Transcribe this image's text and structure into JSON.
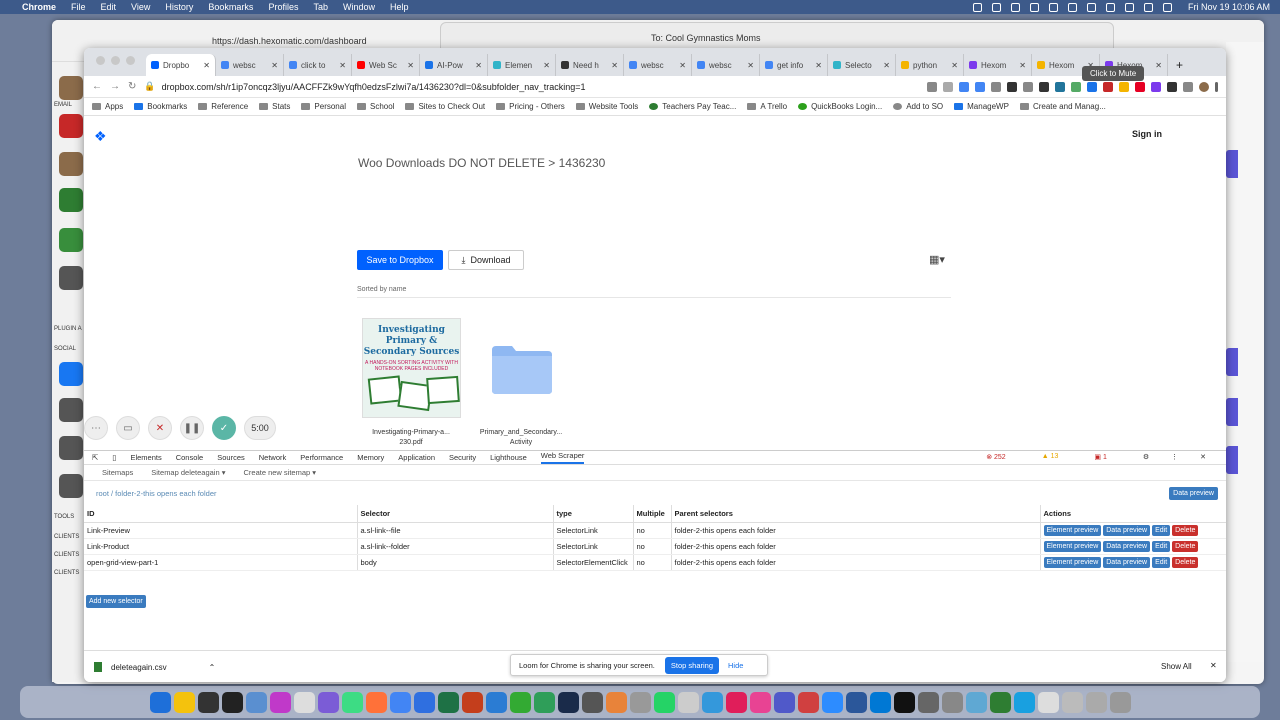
{
  "menubar": {
    "app": "Chrome",
    "items": [
      "File",
      "Edit",
      "View",
      "History",
      "Bookmarks",
      "Profiles",
      "Tab",
      "Window",
      "Help"
    ],
    "datetime": "Fri Nov 19  10:06 AM"
  },
  "back_window": {
    "url": "https://dash.hexomatic.com/dashboard",
    "mail_to": "To:  Cool Gymnastics Moms",
    "left_labels": [
      "EMAIL",
      "PLUGIN A",
      "SOCIAL",
      "TOOLS",
      "CLIENTS",
      "CLIENTS",
      "CLIENTS"
    ]
  },
  "tabs": [
    {
      "label": "Dropbo",
      "color": "#0061fe",
      "active": true
    },
    {
      "label": "websc",
      "color": "#4285f4"
    },
    {
      "label": "click to",
      "color": "#4285f4"
    },
    {
      "label": "Web Sc",
      "color": "#ff0000"
    },
    {
      "label": "AI-Pow",
      "color": "#1a73e8"
    },
    {
      "label": "Elemen",
      "color": "#30b4c9"
    },
    {
      "label": "Need h",
      "color": "#333333"
    },
    {
      "label": "websc",
      "color": "#4285f4"
    },
    {
      "label": "websc",
      "color": "#4285f4"
    },
    {
      "label": "get info",
      "color": "#4285f4"
    },
    {
      "label": "Selecto",
      "color": "#30b4c9"
    },
    {
      "label": "python",
      "color": "#f4b400"
    },
    {
      "label": "Hexom",
      "color": "#7c3aed"
    },
    {
      "label": "Hexom",
      "color": "#f4b400"
    },
    {
      "label": "Hexom",
      "color": "#7c3aed"
    }
  ],
  "address": "dropbox.com/sh/r1ip7oncqz3ljyu/AACFFZk9wYqfh0edzsFzlwi7a/1436230?dl=0&subfolder_nav_tracking=1",
  "bookmarks": [
    "Apps",
    "Bookmarks",
    "Reference",
    "Stats",
    "Personal",
    "School",
    "Sites to Check Out",
    "Pricing - Others",
    "Website Tools",
    "Teachers Pay Teac...",
    "A Trello",
    "QuickBooks Login...",
    "Add to SO",
    "ManageWP",
    "Create and Manag..."
  ],
  "dropbox": {
    "signin": "Sign in",
    "tooltip": "Click to Mute",
    "breadcrumb": "Woo Downloads DO NOT DELETE  >  1436230",
    "save_label": "Save to Dropbox",
    "download_label": "Download",
    "sorted": "Sorted by name",
    "file1_thumb_title": "Investigating Primary & Secondary Sources",
    "file1_thumb_sub": "A HANDS-ON SORTING ACTIVITY WITH NOTEBOOK PAGES INCLUDED",
    "file1_name_1": "Investigating-Primary-a...",
    "file1_name_2": "230.pdf",
    "folder_name_1": "Primary_and_Secondary...",
    "folder_name_2": "Activity"
  },
  "recorder": {
    "timer": "5:00"
  },
  "devtools": {
    "tabs": [
      "Elements",
      "Console",
      "Sources",
      "Network",
      "Performance",
      "Memory",
      "Application",
      "Security",
      "Lighthouse",
      "Web Scraper"
    ],
    "errors": "252",
    "warnings": "13",
    "issues": "1"
  },
  "scraper": {
    "menu": [
      "Sitemaps",
      "Sitemap deleteagain ▾",
      "Create new sitemap ▾"
    ],
    "crumb": "root  /  folder-2-this opens each folder",
    "data_preview": "Data preview",
    "headers": {
      "id": "ID",
      "selector": "Selector",
      "type": "type",
      "multiple": "Multiple",
      "parent": "Parent selectors",
      "actions": "Actions"
    },
    "rows": [
      {
        "id": "Link-Preview",
        "selector": "a.sl-link--file",
        "type": "SelectorLink",
        "multiple": "no",
        "parent": "folder-2-this opens each folder"
      },
      {
        "id": "Link-Product",
        "selector": "a.sl-link--folder",
        "type": "SelectorLink",
        "multiple": "no",
        "parent": "folder-2-this opens each folder"
      },
      {
        "id": "open-grid-view-part-1",
        "selector": "body",
        "type": "SelectorElementClick",
        "multiple": "no",
        "parent": "folder-2-this opens each folder"
      }
    ],
    "actions": {
      "element_preview": "Element preview",
      "data_preview": "Data preview",
      "edit": "Edit",
      "delete": "Delete"
    },
    "add_selector": "Add new selector"
  },
  "downloads": {
    "file": "deleteagain.csv",
    "show_all": "Show All"
  },
  "share_bar": {
    "text": "Loom for Chrome is sharing your screen.",
    "stop": "Stop sharing",
    "hide": "Hide"
  }
}
